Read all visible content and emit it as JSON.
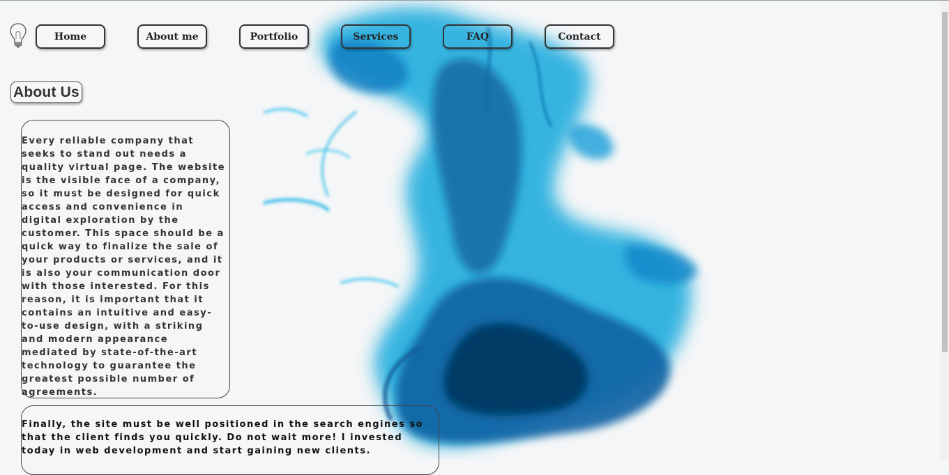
{
  "nav": {
    "items": [
      {
        "label": "Home"
      },
      {
        "label": "About me"
      },
      {
        "label": "Portfolio"
      },
      {
        "label": "Services"
      },
      {
        "label": "FAQ"
      },
      {
        "label": "Contact"
      }
    ],
    "logo_icon": "lightbulb-icon"
  },
  "main": {
    "title": "About Us",
    "paragraph_1": "Every reliable company that seeks to stand out needs a quality virtual page. The website is the visible face of a company, so it must be designed for quick access and convenience in digital exploration by the customer. This space should be a quick way to finalize the sale of your products or services, and it is also your communication door with those interested. For this reason, it is important that it contains an intuitive and easy-to-use design, with a striking and modern appearance mediated by state-of-the-art technology to guarantee the greatest possible number of agreements.",
    "paragraph_2": "Finally, the site must be well positioned in the search engines so that the client finds you quickly. Do not wait more! I invested today in web development and start gaining new clients."
  },
  "colors": {
    "ink_light": "#1fb6e6",
    "ink_mid": "#0a7fc4",
    "ink_dark": "#07406e",
    "background": "#f4f6f7",
    "border": "#333333"
  }
}
